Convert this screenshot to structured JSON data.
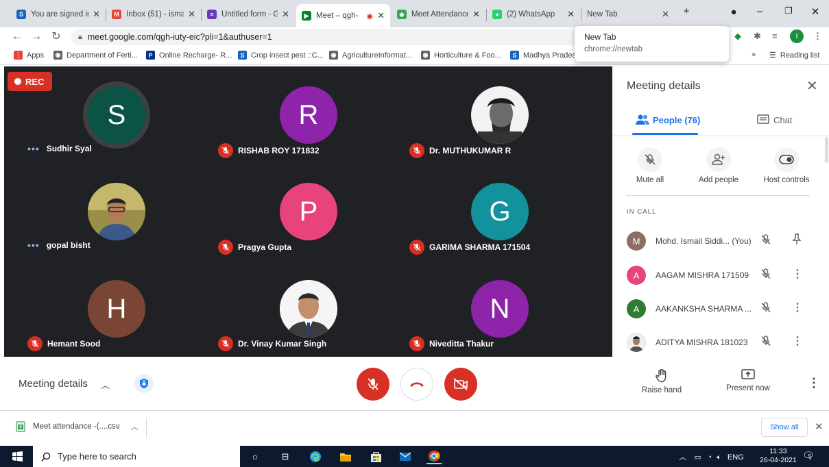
{
  "browser": {
    "tabs": [
      {
        "title": "You are signed in",
        "icon": "s-icon",
        "color": "#1565c0",
        "letter": "S"
      },
      {
        "title": "Inbox (51) - ismai",
        "icon": "gmail-icon",
        "color": "#ea4335",
        "letter": "M"
      },
      {
        "title": "Untitled form - G",
        "icon": "forms-icon",
        "color": "#673ab7",
        "letter": "≡"
      },
      {
        "title": "Meet – qgh-",
        "icon": "meet-icon",
        "color": "#00832d",
        "letter": "▶"
      },
      {
        "title": "Meet Attendance",
        "icon": "meet-attendance-icon",
        "color": "#34a853",
        "letter": "◆"
      },
      {
        "title": "(2) WhatsApp",
        "icon": "whatsapp-icon",
        "color": "#25d366",
        "letter": "●"
      },
      {
        "title": "New Tab",
        "icon": "",
        "color": "",
        "letter": ""
      }
    ],
    "url": "meet.google.com/qgh-iuty-eic?pli=1&authuser=1",
    "profile_letter": "I",
    "bookmarks": [
      {
        "label": "Apps",
        "color": "#ea4335",
        "letter": "⋮"
      },
      {
        "label": "Department of Ferti...",
        "color": "#5f6368",
        "letter": "◉"
      },
      {
        "label": "Online Recharge- R...",
        "color": "#003087",
        "letter": "P"
      },
      {
        "label": "Crop insect pest ::C...",
        "color": "#1565c0",
        "letter": "S"
      },
      {
        "label": "AgricultureInformat...",
        "color": "#5f6368",
        "letter": "◉"
      },
      {
        "label": "Horticulture & Foo...",
        "color": "#5f6368",
        "letter": "◉"
      },
      {
        "label": "Madhya Prades",
        "color": "#1565c0",
        "letter": "S"
      }
    ],
    "bookmarks_more": "»",
    "reading_list": "Reading list",
    "tooltip": {
      "title": "New Tab",
      "url": "chrome://newtab"
    }
  },
  "meet": {
    "rec_label": "REC",
    "tiles": [
      {
        "name": "Sudhir Syal",
        "initial": "S",
        "bg": "#0b5345",
        "status": "speaking"
      },
      {
        "name": "RISHAB ROY 171832",
        "initial": "R",
        "bg": "#8e24aa",
        "status": "muted"
      },
      {
        "name": "Dr. MUTHUKUMAR R",
        "initial": "",
        "bg": "#424242",
        "status": "muted",
        "photo": true
      },
      {
        "name": "gopal bisht",
        "initial": "",
        "bg": "#6d6b4f",
        "status": "speaking",
        "photo": true
      },
      {
        "name": "Pragya Gupta",
        "initial": "P",
        "bg": "#e8437c",
        "status": "muted"
      },
      {
        "name": "GARIMA SHARMA 171504",
        "initial": "G",
        "bg": "#12929c",
        "status": "muted"
      },
      {
        "name": "Hemant Sood",
        "initial": "H",
        "bg": "#7a4535",
        "status": "muted"
      },
      {
        "name": "Dr. Vinay Kumar Singh",
        "initial": "",
        "bg": "#f5f5f5",
        "status": "muted",
        "photo": true
      },
      {
        "name": "Niveditta Thakur",
        "initial": "N",
        "bg": "#8e24aa",
        "status": "muted"
      }
    ]
  },
  "panel": {
    "title": "Meeting details",
    "people_tab": "People (76)",
    "chat_tab": "Chat",
    "actions": [
      "Mute all",
      "Add people",
      "Host controls"
    ],
    "section": "IN CALL",
    "people": [
      {
        "name": "Mohd. Ismail Siddi... (You)",
        "initial": "M",
        "bg": "#8d6e63",
        "action": "pin"
      },
      {
        "name": "AAGAM MISHRA 171509",
        "initial": "A",
        "bg": "#e8437c",
        "action": "more"
      },
      {
        "name": "AAKANKSHA SHARMA ...",
        "initial": "A",
        "bg": "#2e7d32",
        "action": "more"
      },
      {
        "name": "ADITYA MISHRA 181023",
        "initial": "",
        "bg": "#6d6b4f",
        "action": "more"
      }
    ]
  },
  "bottom": {
    "details_label": "Meeting details",
    "raise_hand": "Raise hand",
    "present_now": "Present now"
  },
  "download": {
    "file": "Meet attendance -(....csv",
    "show_all": "Show all"
  },
  "taskbar": {
    "search_placeholder": "Type here to search",
    "lang": "ENG",
    "time": "11:33",
    "date": "26-04-2021",
    "notif_count": "5"
  }
}
